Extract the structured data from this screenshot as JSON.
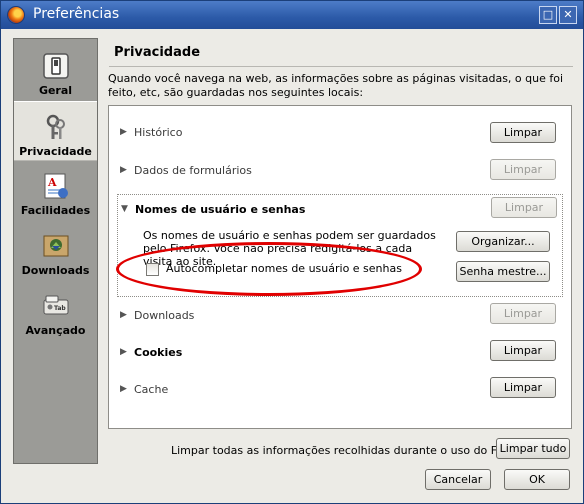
{
  "window": {
    "title": "Preferências",
    "icon": "firefox-icon"
  },
  "titlebar_buttons": [
    {
      "name": "maximize",
      "glyph": "□"
    },
    {
      "name": "close",
      "glyph": "✕"
    }
  ],
  "sidebar": {
    "items": [
      {
        "label": "Geral",
        "icon": "switch-icon"
      },
      {
        "label": "Privacidade",
        "icon": "keys-icon"
      },
      {
        "label": "Facilidades",
        "icon": "document-icon"
      },
      {
        "label": "Downloads",
        "icon": "download-box-icon"
      },
      {
        "label": "Avançado",
        "icon": "tab-icon"
      }
    ],
    "selected": "Privacidade"
  },
  "panel": {
    "title": "Privacidade",
    "intro": "Quando você navega na web, as informações sobre as páginas visitadas, o que foi feito, etc, são guardadas nos seguintes locais:"
  },
  "items": [
    {
      "label": "Histórico",
      "button": "Limpar",
      "enabled": true
    },
    {
      "label": "Dados de formulários",
      "button": "Limpar",
      "enabled": false
    },
    {
      "label": "Nomes de usuário e senhas",
      "button": "Limpar",
      "enabled": false
    },
    {
      "label": "Downloads",
      "button": "Limpar",
      "enabled": false
    },
    {
      "label": "Cookies",
      "button": "Limpar",
      "enabled": true
    },
    {
      "label": "Cache",
      "button": "Limpar",
      "enabled": true
    }
  ],
  "expanded": {
    "description": "Os nomes de usuário e senhas podem ser guardados pelo Firefox. Você não precisa redigitá-los a cada visita ao site.",
    "checkbox_label": "Autocompletar nomes de usuário e senhas",
    "checkbox_checked": false,
    "organize_button": "Organizar...",
    "master_password_button": "Senha mestre..."
  },
  "footer": {
    "clear_all_text": "Limpar todas as informações recolhidas durante o uso do Firefox:",
    "clear_all_button": "Limpar tudo",
    "cancel_button": "Cancelar",
    "ok_button": "OK"
  },
  "colors": {
    "highlight": "#e00000",
    "titlebar": "#2c5aa8"
  }
}
